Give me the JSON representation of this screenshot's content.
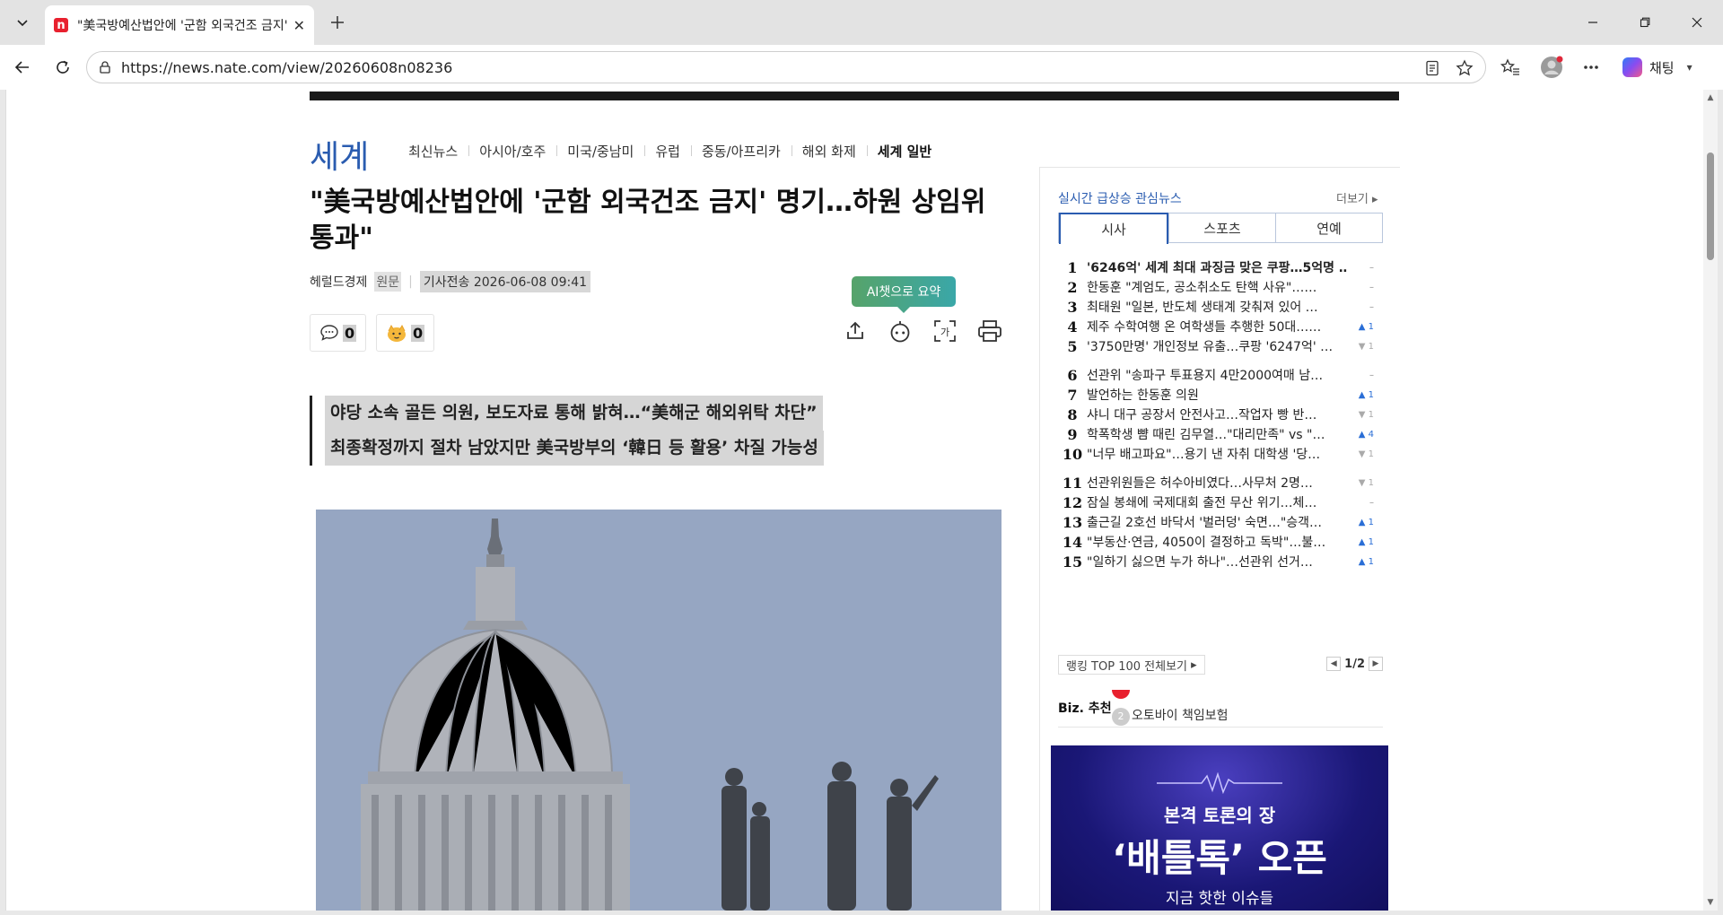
{
  "browser": {
    "tab_title": "\"美국방예산법안에 '군함 외국건조 금지' 명기…하원 상임위 통과\"",
    "tab_favicon": "n",
    "url": "https://news.nate.com/view/20260608n08236",
    "chat_label": "채팅"
  },
  "section": {
    "title": "세계",
    "nav": [
      "최신뉴스",
      "아시아/호주",
      "미국/중남미",
      "유럽",
      "중동/아프리카",
      "해외 화제",
      "세계 일반"
    ],
    "active_index": 6
  },
  "article": {
    "headline": "\"美국방예산법안에 '군함 외국건조 금지' 명기…하원 상임위 통과\"",
    "source": "헤럴드경제",
    "original": "원문",
    "date_label": "기사전송 2026-06-08 09:41",
    "comment_count": "0",
    "reaction_count": "0",
    "ai_tooltip": "AI챗으로 요약",
    "font_icon_label": "가",
    "subhead": [
      "야당 소속 골든 의원, 보도자료 통해 밝혀…“美해군 해외위탁 차단”",
      "최종확정까지 절차 남았지만 美국방부의 ‘韓日 등 활용’ 차질 가능성"
    ]
  },
  "sidebar": {
    "title": "실시간 급상승 관심뉴스",
    "more": "더보기",
    "tabs": [
      "시사",
      "스포츠",
      "연예"
    ],
    "active_tab": 0,
    "ranks": [
      {
        "no": "1",
        "text": "'6246억' 세계 최대 과징금 맞은 쿠팡…5억명 …",
        "chg": "–",
        "dir": "same",
        "bold": true
      },
      {
        "no": "2",
        "text": "한동훈 \"계엄도, 공소취소도 탄핵 사유\"……",
        "chg": "–",
        "dir": "same"
      },
      {
        "no": "3",
        "text": "최태원 \"일본, 반도체 생태계 갖춰져 있어 …",
        "chg": "–",
        "dir": "same"
      },
      {
        "no": "4",
        "text": "제주 수학여행 온 여학생들 추행한 50대……",
        "chg": "1",
        "dir": "up"
      },
      {
        "no": "5",
        "text": "'3750만명' 개인정보 유출…쿠팡 '6247억' …",
        "chg": "1",
        "dir": "down"
      },
      {
        "no": "6",
        "text": "선관위 \"송파구 투표용지 4만2000여매 남…",
        "chg": "–",
        "dir": "same"
      },
      {
        "no": "7",
        "text": "발언하는 한동훈 의원",
        "chg": "1",
        "dir": "up"
      },
      {
        "no": "8",
        "text": "샤니 대구 공장서 안전사고…작업자 빵 반…",
        "chg": "1",
        "dir": "down"
      },
      {
        "no": "9",
        "text": "학폭학생 뺨 때린 김무열…\"대리만족\" vs \"…",
        "chg": "4",
        "dir": "up"
      },
      {
        "no": "10",
        "text": "\"너무 배고파요\"…용기 낸 자취 대학생 '당…",
        "chg": "1",
        "dir": "down"
      },
      {
        "no": "11",
        "text": "선관위원들은 허수아비였다…사무처 2명…",
        "chg": "1",
        "dir": "down"
      },
      {
        "no": "12",
        "text": "잠실 봉쇄에 국제대회 출전 무산 위기…체…",
        "chg": "–",
        "dir": "same"
      },
      {
        "no": "13",
        "text": "출근길 2호선 바닥서 '벌러덩' 숙면…\"승객…",
        "chg": "1",
        "dir": "up"
      },
      {
        "no": "14",
        "text": "\"부동산·연금, 4050이 결정하고 독박\"…불…",
        "chg": "1",
        "dir": "up"
      },
      {
        "no": "15",
        "text": "\"일하기 싫으면 누가 하나\"…선관위 선거…",
        "chg": "1",
        "dir": "up"
      }
    ],
    "rank_all": "랭킹 TOP 100 전체보기",
    "pager": "1/2",
    "biz_label": "Biz. 추천",
    "biz_item": "오토바이 책임보험",
    "biz_no": "2",
    "ad": {
      "line1": "본격 토론의 장",
      "line2": "‘배틀톡’ 오픈",
      "line3": "지금 핫한 이슈들"
    }
  }
}
